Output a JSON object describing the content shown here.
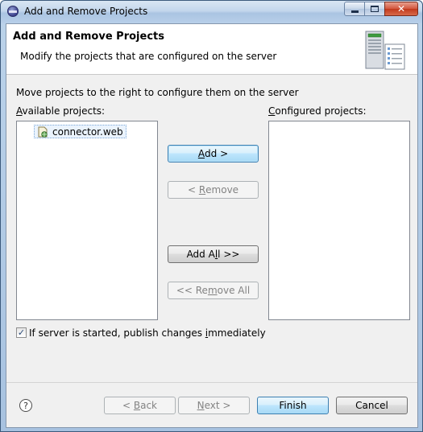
{
  "window": {
    "title": "Add and Remove Projects"
  },
  "banner": {
    "title": "Add and Remove Projects",
    "description": "Modify the projects that are configured on the server"
  },
  "content": {
    "instruction": "Move projects to the right to configure them on the server",
    "available_label_mnemonic": "A",
    "available_label_rest": "vailable projects:",
    "configured_label_mnemonic": "C",
    "configured_label_rest": "onfigured projects:",
    "available_projects": [
      "connector.web"
    ],
    "configured_projects": []
  },
  "buttons": {
    "add_pre": "",
    "add_mnemonic": "A",
    "add_post": "dd >",
    "remove_pre": "< ",
    "remove_mnemonic": "R",
    "remove_post": "emove",
    "add_all_pre": "Add A",
    "add_all_mnemonic": "l",
    "add_all_post": "l >>",
    "remove_all_pre": "<< Re",
    "remove_all_mnemonic": "m",
    "remove_all_post": "ove All"
  },
  "publish_option": {
    "checked": true,
    "label_pre": "If server is started, publish changes ",
    "label_mnemonic": "i",
    "label_post": "mmediately"
  },
  "footer": {
    "help_glyph": "?",
    "back_pre": "< ",
    "back_mnemonic": "B",
    "back_post": "ack",
    "next_mnemonic": "N",
    "next_post": "ext >",
    "finish_label": "Finish",
    "cancel_label": "Cancel"
  },
  "icons": {
    "app": "eclipse-icon",
    "banner": "server-icon",
    "project": "web-project-icon",
    "help": "help-icon"
  }
}
